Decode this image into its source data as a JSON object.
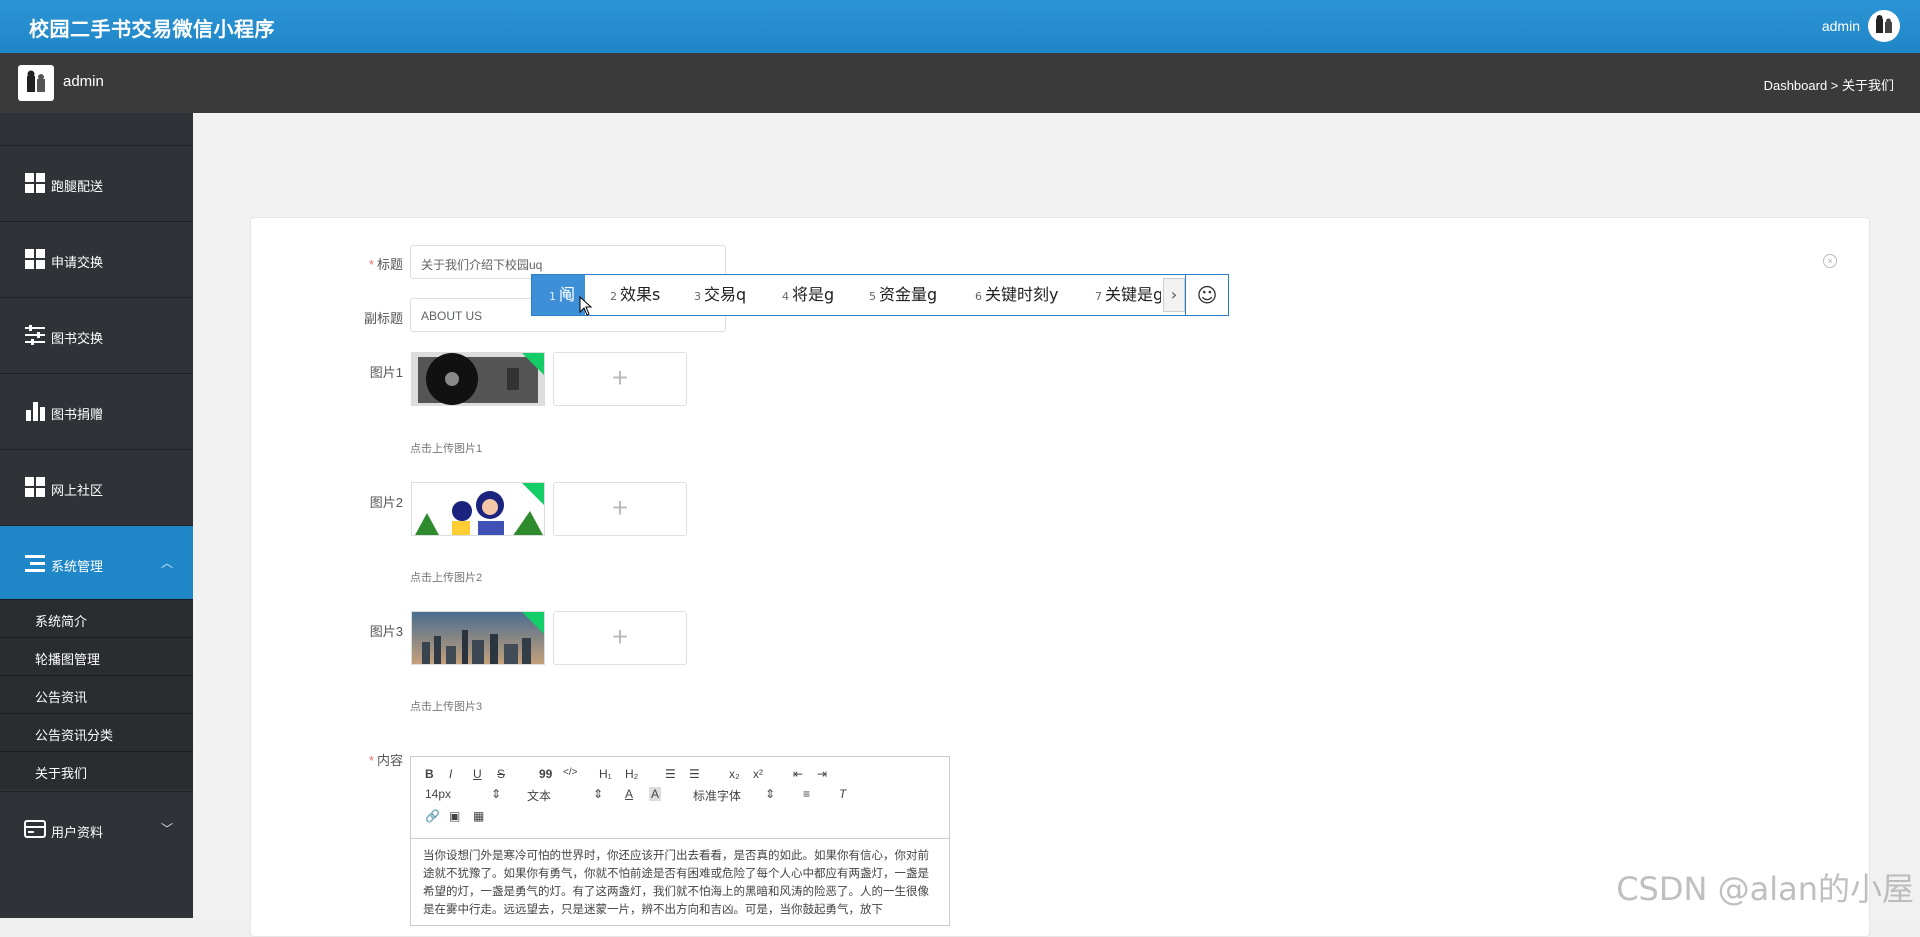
{
  "header": {
    "app_title": "校园二手书交易微信小程序",
    "user": "admin"
  },
  "subbar": {
    "name": "admin",
    "breadcrumb": "Dashboard > 关于我们"
  },
  "sidebar": {
    "items": [
      {
        "label": "跑腿配送",
        "icon": "grid-icon"
      },
      {
        "label": "申请交换",
        "icon": "grid-icon"
      },
      {
        "label": "图书交换",
        "icon": "sliders-icon"
      },
      {
        "label": "图书捐赠",
        "icon": "bar-chart-icon"
      },
      {
        "label": "网上社区",
        "icon": "grid-icon"
      },
      {
        "label": "系统管理",
        "icon": "menu-icon",
        "expanded": true
      },
      {
        "label": "用户资料",
        "icon": "card-icon"
      }
    ],
    "submenu": [
      "系统简介",
      "轮播图管理",
      "公告资讯",
      "公告资讯分类",
      "关于我们"
    ]
  },
  "form": {
    "title_label": "标题",
    "title_value": "关于我们介绍下校园uq",
    "subtitle_label": "副标题",
    "subtitle_value": "ABOUT US",
    "pic1_label": "图片1",
    "pic1_hint": "点击上传图片1",
    "pic2_label": "图片2",
    "pic2_hint": "点击上传图片2",
    "pic3_label": "图片3",
    "pic3_hint": "点击上传图片3",
    "content_label": "内容",
    "plus": "+"
  },
  "ime": {
    "candidates": [
      {
        "num": "1",
        "text": "阄"
      },
      {
        "num": "2",
        "text": "效果s"
      },
      {
        "num": "3",
        "text": "交易q"
      },
      {
        "num": "4",
        "text": "将是g"
      },
      {
        "num": "5",
        "text": "资金量g"
      },
      {
        "num": "6",
        "text": "关键时刻y"
      },
      {
        "num": "7",
        "text": "关键是g"
      }
    ],
    "next": "›",
    "emoji": "☺"
  },
  "editor": {
    "toolbar": {
      "bold": "B",
      "italic": "I",
      "underline": "U",
      "strike": "S",
      "quote": "99",
      "code": "</>",
      "h1": "H₁",
      "h2": "H₂",
      "sub": "x₂",
      "sup": "x²",
      "size": "14px",
      "text_type": "文本",
      "font": "标准字体"
    },
    "body": "当你设想门外是寒冷可怕的世界时，你还应该开门出去看看，是否真的如此。如果你有信心，你对前途就不犹豫了。如果你有勇气，你就不怕前途是否有困难或危险了每个人心中都应有两盏灯，一盏是希望的灯，一盏是勇气的灯。有了这两盏灯，我们就不怕海上的黑暗和风涛的险恶了。人的一生很像是在雾中行走。远远望去，只是迷蒙一片，辨不出方向和吉凶。可是，当你鼓起勇气，放下"
  },
  "watermark": "CSDN @alan的小屋"
}
